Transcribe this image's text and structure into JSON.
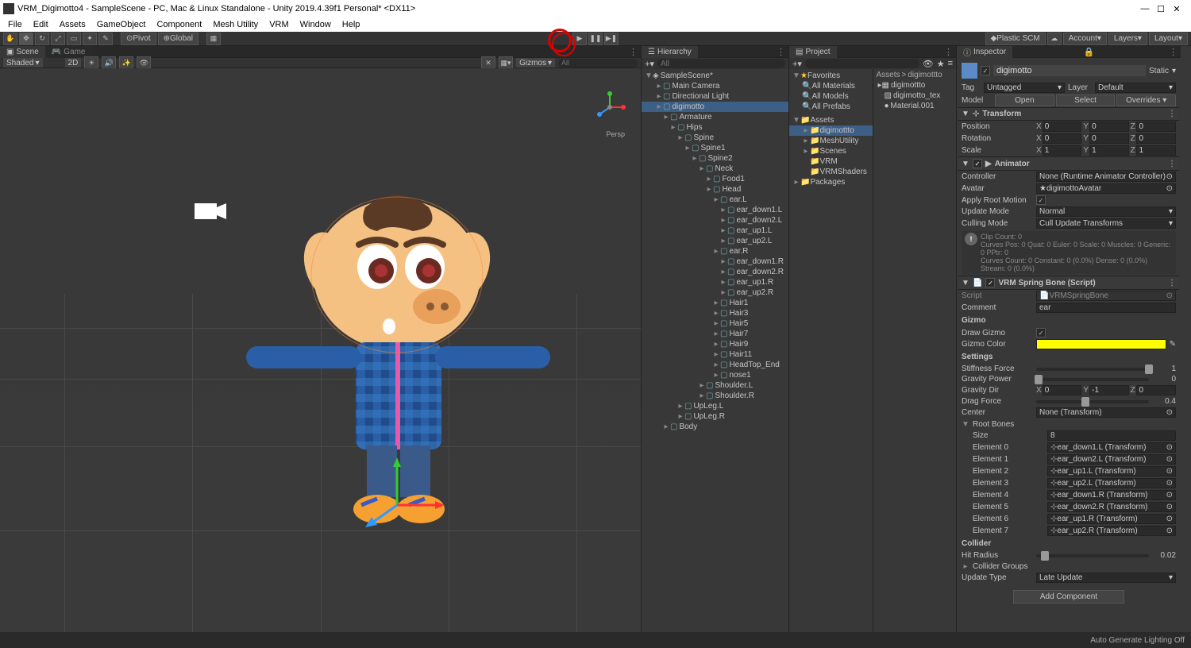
{
  "window": {
    "title": "VRM_Digimotto4 - SampleScene - PC, Mac & Linux Standalone - Unity 2019.4.39f1 Personal* <DX11>"
  },
  "menus": [
    "File",
    "Edit",
    "Assets",
    "GameObject",
    "Component",
    "Mesh Utility",
    "VRM",
    "Window",
    "Help"
  ],
  "toolbar": {
    "pivot": "Pivot",
    "global": "Global",
    "plastic": "Plastic SCM",
    "account": "Account",
    "layers": "Layers",
    "layout": "Layout"
  },
  "scene": {
    "tab_scene": "Scene",
    "tab_game": "Game",
    "shading": "Shaded",
    "shading_mode": "2D",
    "gizmos": "Gizmos",
    "persp": "Persp",
    "search_placeholder": "All"
  },
  "hierarchy": {
    "title": "Hierarchy",
    "search_placeholder": "All",
    "scene": "SampleScene*",
    "items": [
      {
        "d": 1,
        "n": "Main Camera"
      },
      {
        "d": 1,
        "n": "Directional Light"
      },
      {
        "d": 1,
        "n": "digimotto",
        "sel": true
      },
      {
        "d": 2,
        "n": "Armature"
      },
      {
        "d": 3,
        "n": "Hips"
      },
      {
        "d": 4,
        "n": "Spine"
      },
      {
        "d": 5,
        "n": "Spine1"
      },
      {
        "d": 6,
        "n": "Spine2"
      },
      {
        "d": 7,
        "n": "Neck"
      },
      {
        "d": 8,
        "n": "Food1"
      },
      {
        "d": 8,
        "n": "Head"
      },
      {
        "d": 9,
        "n": "ear.L"
      },
      {
        "d": 10,
        "n": "ear_down1.L"
      },
      {
        "d": 10,
        "n": "ear_down2.L"
      },
      {
        "d": 10,
        "n": "ear_up1.L"
      },
      {
        "d": 10,
        "n": "ear_up2.L"
      },
      {
        "d": 9,
        "n": "ear.R"
      },
      {
        "d": 10,
        "n": "ear_down1.R"
      },
      {
        "d": 10,
        "n": "ear_down2.R"
      },
      {
        "d": 10,
        "n": "ear_up1.R"
      },
      {
        "d": 10,
        "n": "ear_up2.R"
      },
      {
        "d": 9,
        "n": "Hair1"
      },
      {
        "d": 9,
        "n": "Hair3"
      },
      {
        "d": 9,
        "n": "Hair5"
      },
      {
        "d": 9,
        "n": "Hair7"
      },
      {
        "d": 9,
        "n": "Hair9"
      },
      {
        "d": 9,
        "n": "Hair11"
      },
      {
        "d": 9,
        "n": "HeadTop_End"
      },
      {
        "d": 9,
        "n": "nose1"
      },
      {
        "d": 7,
        "n": "Shoulder.L"
      },
      {
        "d": 7,
        "n": "Shoulder.R"
      },
      {
        "d": 4,
        "n": "UpLeg.L"
      },
      {
        "d": 4,
        "n": "UpLeg.R"
      },
      {
        "d": 2,
        "n": "Body"
      }
    ]
  },
  "project": {
    "title": "Project",
    "search_placeholder": "",
    "breadcrumb": [
      "Assets",
      "digimottto"
    ],
    "favorites": "Favorites",
    "fav_items": [
      "All Materials",
      "All Models",
      "All Prefabs"
    ],
    "assets": "Assets",
    "asset_folders": [
      "digimottto",
      "MeshUtility",
      "Scenes",
      "VRM",
      "VRMShaders"
    ],
    "packages": "Packages",
    "files": [
      "digimottto",
      "digimotto_tex",
      "Material.001"
    ]
  },
  "inspector": {
    "title": "Inspector",
    "name": "digimotto",
    "static": "Static",
    "tag_label": "Tag",
    "tag_value": "Untagged",
    "layer_label": "Layer",
    "layer_value": "Default",
    "model_label": "Model",
    "open": "Open",
    "select": "Select",
    "overrides": "Overrides",
    "transform": {
      "title": "Transform",
      "position": "Position",
      "px": "0",
      "py": "0",
      "pz": "0",
      "rotation": "Rotation",
      "rx": "0",
      "ry": "0",
      "rz": "0",
      "scale": "Scale",
      "sx": "1",
      "sy": "1",
      "sz": "1"
    },
    "animator": {
      "title": "Animator",
      "controller_label": "Controller",
      "controller": "None (Runtime Animator Controller)",
      "avatar_label": "Avatar",
      "avatar": "digimottoAvatar",
      "apply_root": "Apply Root Motion",
      "update_mode_label": "Update Mode",
      "update_mode": "Normal",
      "culling_label": "Culling Mode",
      "culling": "Cull Update Transforms",
      "info1": "Clip Count: 0",
      "info2": "Curves Pos: 0 Quat: 0 Euler: 0 Scale: 0 Muscles: 0 Generic: 0 PPtr: 0",
      "info3": "Curves Count: 0 Constant: 0 (0.0%) Dense: 0 (0.0%) Stream: 0 (0.0%)"
    },
    "springbone": {
      "title": "VRM Spring Bone (Script)",
      "script_label": "Script",
      "script": "VRMSpringBone",
      "comment_label": "Comment",
      "comment": "ear",
      "gizmo_section": "Gizmo",
      "draw_gizmo": "Draw Gizmo",
      "gizmo_color": "Gizmo Color",
      "settings_section": "Settings",
      "stiffness": "Stiffness Force",
      "stiffness_val": "1",
      "gravity_power": "Gravity Power",
      "gravity_power_val": "0",
      "gravity_dir": "Gravity Dir",
      "gx": "0",
      "gy": "-1",
      "gz": "0",
      "drag": "Drag Force",
      "drag_val": "0.4",
      "center_label": "Center",
      "center": "None (Transform)",
      "root_bones": "Root Bones",
      "size_label": "Size",
      "size": "8",
      "elements": [
        {
          "label": "Element 0",
          "val": "ear_down1.L (Transform)"
        },
        {
          "label": "Element 1",
          "val": "ear_down2.L (Transform)"
        },
        {
          "label": "Element 2",
          "val": "ear_up1.L (Transform)"
        },
        {
          "label": "Element 3",
          "val": "ear_up2.L (Transform)"
        },
        {
          "label": "Element 4",
          "val": "ear_down1.R (Transform)"
        },
        {
          "label": "Element 5",
          "val": "ear_down2.R (Transform)"
        },
        {
          "label": "Element 6",
          "val": "ear_up1.R (Transform)"
        },
        {
          "label": "Element 7",
          "val": "ear_up2.R (Transform)"
        }
      ],
      "collider_section": "Collider",
      "hit_radius": "Hit Radius",
      "hit_radius_val": "0.02",
      "collider_groups": "Collider Groups",
      "update_type_label": "Update Type",
      "update_type": "Late Update"
    },
    "add_component": "Add Component"
  },
  "statusbar": {
    "lighting": "Auto Generate Lighting Off"
  }
}
